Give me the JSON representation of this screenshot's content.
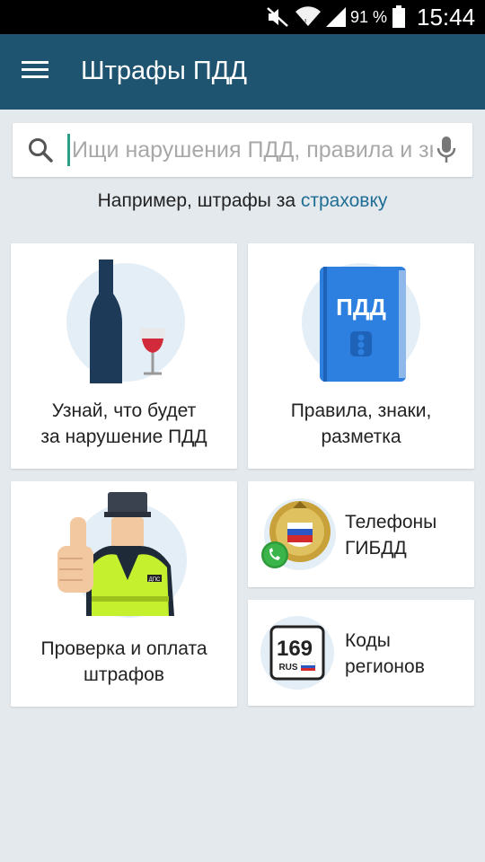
{
  "status_bar": {
    "battery_percent": "91 %",
    "time": "15:44"
  },
  "app_bar": {
    "title": "Штрафы ПДД",
    "menu_icon": "hamburger-menu-icon"
  },
  "search": {
    "placeholder": "Ищи нарушения ПДД, правила и знаки",
    "value": "",
    "search_icon": "search-icon",
    "mic_icon": "microphone-icon"
  },
  "hint": {
    "prefix": "Например, штрафы за ",
    "link": "страховку"
  },
  "cards": {
    "violations": {
      "line1": "Узнай, что будет",
      "line2": "за нарушение ПДД",
      "icon": "wine-bottle-icon"
    },
    "rules": {
      "line1": "Правила, знаки,",
      "line2": "разметка",
      "icon": "rules-book-icon",
      "book_label": "ПДД"
    },
    "fines": {
      "line1": "Проверка и оплата",
      "line2": "штрафов",
      "icon": "traffic-officer-icon",
      "badge": "ДПС"
    },
    "phones": {
      "line1": "Телефоны",
      "line2": "ГИБДД",
      "icon": "gibdd-emblem-phone-icon"
    },
    "regions": {
      "line1": "Коды",
      "line2": "регионов",
      "icon": "license-plate-region-icon",
      "plate_number": "169",
      "plate_country": "RUS"
    }
  },
  "colors": {
    "app_bar": "#1f5470",
    "background": "#e4e9ee",
    "accent_link": "#1f6e94",
    "book_blue": "#2d7fe0",
    "vest_green": "#c4f02e"
  }
}
